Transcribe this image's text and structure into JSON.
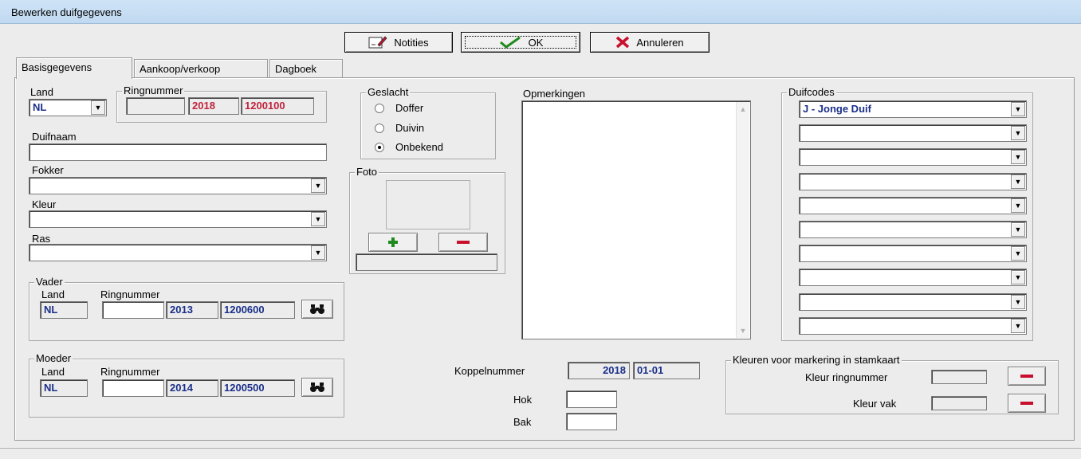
{
  "window": {
    "title": "Bewerken duifgegevens"
  },
  "toolbar": {
    "notes_label": "Notities",
    "ok_label": "OK",
    "cancel_label": "Annuleren"
  },
  "tabs": [
    {
      "label": "Basisgegevens"
    },
    {
      "label": "Aankoop/verkoop"
    },
    {
      "label": "Dagboek"
    }
  ],
  "ring": {
    "land_label": "Land",
    "land_value": "NL",
    "group_label": "Ringnummer",
    "prefix": "",
    "year": "2018",
    "number": "1200100"
  },
  "duifnaam": {
    "label": "Duifnaam",
    "value": ""
  },
  "fokker": {
    "label": "Fokker",
    "value": ""
  },
  "kleur": {
    "label": "Kleur",
    "value": ""
  },
  "ras": {
    "label": "Ras",
    "value": ""
  },
  "vader": {
    "group_label": "Vader",
    "land_label": "Land",
    "ring_label": "Ringnummer",
    "land": "NL",
    "prefix": "",
    "year": "2013",
    "number": "1200600"
  },
  "moeder": {
    "group_label": "Moeder",
    "land_label": "Land",
    "ring_label": "Ringnummer",
    "land": "NL",
    "prefix": "",
    "year": "2014",
    "number": "1200500"
  },
  "geslacht": {
    "group_label": "Geslacht",
    "options": [
      {
        "label": "Doffer",
        "selected": false
      },
      {
        "label": "Duivin",
        "selected": false
      },
      {
        "label": "Onbekend",
        "selected": true
      }
    ]
  },
  "foto": {
    "group_label": "Foto",
    "caption": ""
  },
  "opmerkingen": {
    "label": "Opmerkingen",
    "value": ""
  },
  "duifcodes": {
    "group_label": "Duifcodes",
    "codes": [
      "J - Jonge Duif",
      "",
      "",
      "",
      "",
      "",
      "",
      "",
      "",
      ""
    ]
  },
  "koppel": {
    "label": "Koppelnummer",
    "year": "2018",
    "number": "01-01"
  },
  "hok": {
    "label": "Hok",
    "value": ""
  },
  "bak": {
    "label": "Bak",
    "value": ""
  },
  "markering": {
    "group_label": "Kleuren voor markering in stamkaart",
    "ring_color_label": "Kleur ringnummer",
    "vak_color_label": "Kleur vak"
  },
  "colors": {
    "accent_red": "#c8102e",
    "value_blue": "#1a2f8a",
    "ring_red": "#c0233c"
  },
  "icons": {
    "notes": "notes-edit-icon",
    "ok": "checkmark-icon",
    "cancel": "red-x-icon",
    "search": "binoculars-icon",
    "add": "green-plus-icon",
    "remove": "red-minus-icon"
  }
}
